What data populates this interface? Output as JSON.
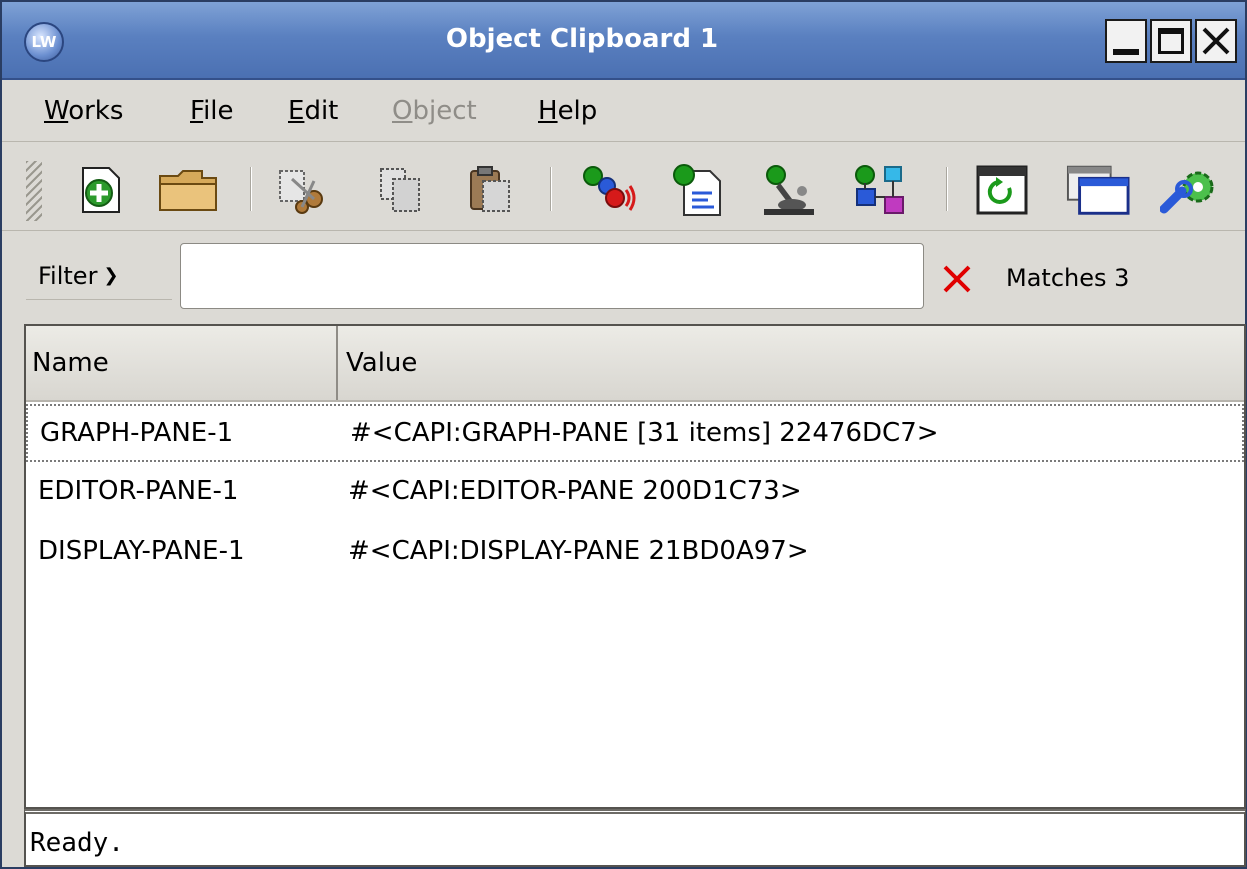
{
  "window": {
    "title": "Object Clipboard 1",
    "app_icon_text": "LW"
  },
  "menu": [
    {
      "label": "Works",
      "mnemonic": "W",
      "rest": "orks",
      "enabled": true
    },
    {
      "label": "File",
      "mnemonic": "F",
      "rest": "ile",
      "enabled": true
    },
    {
      "label": "Edit",
      "mnemonic": "E",
      "rest": "dit",
      "enabled": true
    },
    {
      "label": "Object",
      "mnemonic": "O",
      "rest": "bject",
      "enabled": false
    },
    {
      "label": "Help",
      "mnemonic": "H",
      "rest": "elp",
      "enabled": true
    }
  ],
  "toolbar": {
    "buttons": [
      {
        "icon": "new-icon"
      },
      {
        "icon": "open-folder-icon"
      },
      {
        "icon": "cut-icon"
      },
      {
        "icon": "copy-icon"
      },
      {
        "icon": "paste-icon"
      },
      {
        "icon": "inspect-icon"
      },
      {
        "icon": "listener-icon"
      },
      {
        "icon": "browser-icon"
      },
      {
        "icon": "class-browser-icon"
      },
      {
        "icon": "refresh-icon"
      },
      {
        "icon": "window-icon"
      },
      {
        "icon": "tools-icon"
      }
    ]
  },
  "filter": {
    "label": "Filter",
    "value": "",
    "matches_text": "Matches 3"
  },
  "list": {
    "columns": [
      "Name",
      "Value"
    ],
    "rows": [
      {
        "name": "GRAPH-PANE-1",
        "value": "#<CAPI:GRAPH-PANE [31 items] 22476DC7>",
        "selected": true
      },
      {
        "name": "EDITOR-PANE-1",
        "value": "#<CAPI:EDITOR-PANE  200D1C73>",
        "selected": false
      },
      {
        "name": "DISPLAY-PANE-1",
        "value": "#<CAPI:DISPLAY-PANE  21BD0A97>",
        "selected": false
      }
    ]
  },
  "status": {
    "text": "Ready."
  },
  "colors": {
    "titlebar": "#5a80c0",
    "clear_x": "#e00000"
  }
}
